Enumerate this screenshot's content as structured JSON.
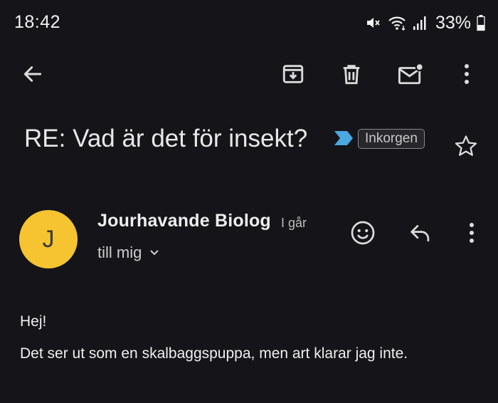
{
  "status": {
    "time": "18:42",
    "battery": "33%",
    "icons": [
      "mute-icon",
      "wifi-icon",
      "signal-icon",
      "battery-icon"
    ]
  },
  "toolbar": {
    "icons": [
      "back-arrow-icon",
      "archive-icon",
      "trash-icon",
      "mark-unread-icon",
      "more-vert-icon"
    ]
  },
  "email": {
    "subject": "RE: Vad är det för insekt?",
    "label": "Inkorgen",
    "importance_color": "#4aa8e0",
    "sender": {
      "name": "Jourhavande Biolog",
      "initial": "J",
      "avatar_color": "#f5c430",
      "time": "I går",
      "recipients": "till mig"
    },
    "body": {
      "greeting": "Hej!",
      "text": "Det ser ut som en skalbaggspuppa, men art klarar jag inte."
    }
  }
}
